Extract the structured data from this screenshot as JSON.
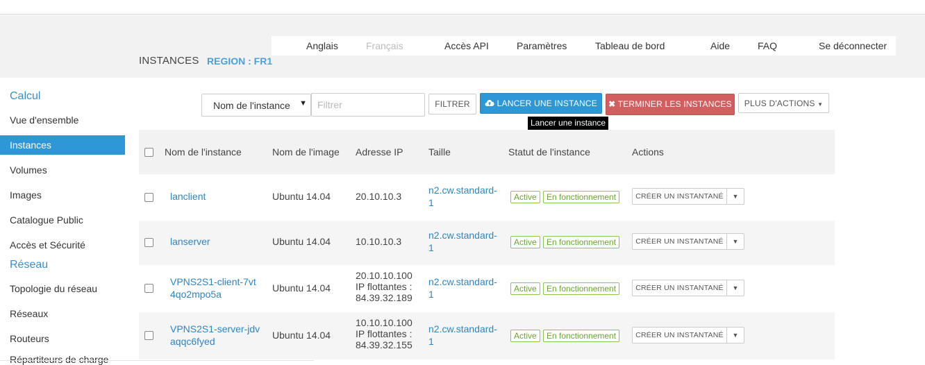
{
  "topnav": {
    "items": [
      "Anglais",
      "Français",
      "Accès API",
      "Paramètres",
      "Tableau de bord",
      "Aide",
      "FAQ",
      "Se déconnecter"
    ]
  },
  "page": {
    "title": "INSTANCES",
    "region": "REGION : FR1"
  },
  "sidebar": {
    "calcul_heading": "Calcul",
    "calcul_items": [
      "Vue d'ensemble",
      "Instances",
      "Volumes",
      "Images",
      "Catalogue Public",
      "Accès et Sécurité"
    ],
    "reseau_heading": "Réseau",
    "reseau_items": [
      "Topologie du réseau",
      "Réseaux",
      "Routeurs",
      "Répartiteurs de charge"
    ],
    "active_item": "Instances"
  },
  "toolbar": {
    "select_value": "Nom de l'instance",
    "filter_placeholder": "Filtrer",
    "filter_label": "FILTRER",
    "launch_label": "LANCER UNE INSTANCE",
    "launch_icon": "cloud-upload-icon",
    "terminate_label": "TERMINER LES INSTANCES",
    "terminate_icon": "close-icon",
    "more_label": "PLUS D'ACTIONS",
    "tooltip": "Lancer une instance"
  },
  "table": {
    "columns": [
      "Nom de l'instance",
      "Nom de l'image",
      "Adresse IP",
      "Taille",
      "Statut de l'instance",
      "Actions"
    ],
    "rows": [
      {
        "name": [
          "lanclient"
        ],
        "image": "Ubuntu 14.04",
        "ip": [
          "20.10.10.3"
        ],
        "size": [
          "n2.cw.standard-",
          "1"
        ],
        "status": "Active",
        "power": "En fonctionnement",
        "action": "CRÉER UN INSTANTANÉ"
      },
      {
        "name": [
          "lanserver"
        ],
        "image": "Ubuntu 14.04",
        "ip": [
          "10.10.10.3"
        ],
        "size": [
          "n2.cw.standard-",
          "1"
        ],
        "status": "Active",
        "power": "En fonctionnement",
        "action": "CRÉER UN INSTANTANÉ"
      },
      {
        "name": [
          "VPNS2S1-client-7vt",
          "4qo2mpo5a"
        ],
        "image": "Ubuntu 14.04",
        "ip": [
          "20.10.10.100",
          "IP flottantes :",
          "84.39.32.189"
        ],
        "size": [
          "n2.cw.standard-",
          "1"
        ],
        "status": "Active",
        "power": "En fonctionnement",
        "action": "CRÉER UN INSTANTANÉ"
      },
      {
        "name": [
          "VPNS2S1-server-jdv",
          "aqqc6fyed"
        ],
        "image": "Ubuntu 14.04",
        "ip": [
          "10.10.10.100",
          "IP flottantes :",
          "84.39.32.155"
        ],
        "size": [
          "n2.cw.standard-",
          "1"
        ],
        "status": "Active",
        "power": "En fonctionnement",
        "action": "CRÉER UN INSTANTANÉ"
      }
    ]
  }
}
